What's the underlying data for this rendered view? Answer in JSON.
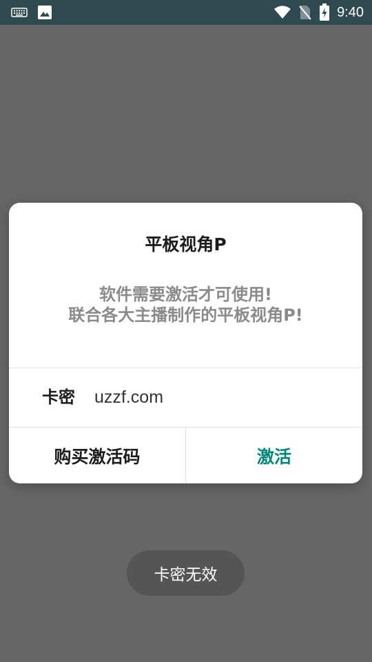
{
  "status_bar": {
    "time": "9:40",
    "icons": [
      "keyboard-icon",
      "image-icon",
      "wifi-icon",
      "no-sim-icon",
      "battery-charging-icon"
    ],
    "background": "#2f4a4f"
  },
  "dialog": {
    "title": "平板视角P",
    "message_line1": "软件需要激活才可使用!",
    "message_line2": "联合各大主播制作的平板视角P!",
    "input_label": "卡密",
    "input_value": "uzzf.com",
    "input_placeholder": "",
    "buy_button_label": "购买激活码",
    "activate_button_label": "激活",
    "accent_color": "#00897b"
  },
  "toast": {
    "text": "卡密无效"
  },
  "colors": {
    "overlay": "#666666",
    "dialog_bg": "#ffffff",
    "toast_bg": "#555555"
  }
}
